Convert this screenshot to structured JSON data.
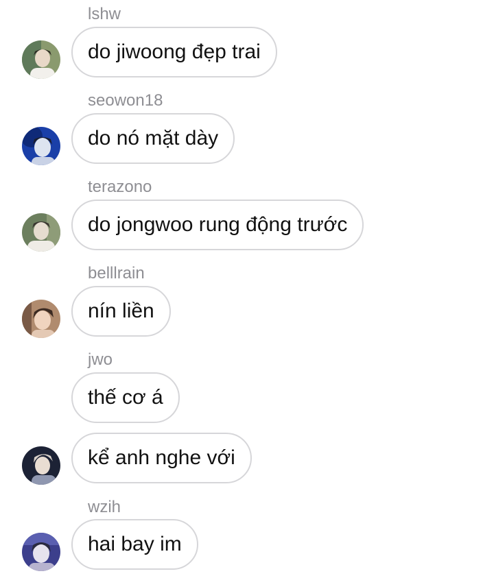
{
  "messages": [
    {
      "sender": "lshw",
      "text": "do jiwoong đẹp trai",
      "avatar": {
        "icon": "user-avatar-icon",
        "bg": "#8a9a6e",
        "face": "#e8d8c8",
        "hair": "#2b2622"
      }
    },
    {
      "sender": "seowon18",
      "text": "do nó mặt dày",
      "avatar": {
        "icon": "user-avatar-icon",
        "bg": "#1a3fa8",
        "face": "#dde4f0",
        "hair": "#1b1f2e"
      }
    },
    {
      "sender": "terazono",
      "text": "do jongwoo rung động trước",
      "avatar": {
        "icon": "user-avatar-icon",
        "bg": "#6c7f5e",
        "face": "#e6dccf",
        "hair": "#3a3530"
      }
    },
    {
      "sender": "belllrain",
      "text": "nín liền",
      "avatar": {
        "icon": "user-avatar-icon",
        "bg": "#b08b6e",
        "face": "#f0d4bf",
        "hair": "#3b2a22"
      }
    },
    {
      "sender": "jwo",
      "text": "thế cơ á",
      "avatar": null
    },
    {
      "sender": "",
      "text": "kể anh nghe với",
      "avatar": {
        "icon": "user-avatar-icon",
        "bg": "#1c2235",
        "face": "#e9ddd2",
        "hair": "#d8d0c8"
      }
    },
    {
      "sender": "wzih",
      "text": "hai bay im",
      "avatar": {
        "icon": "user-avatar-icon",
        "bg": "#3c3f8c",
        "face": "#e6e3ee",
        "hair": "#2a2a40"
      }
    }
  ]
}
